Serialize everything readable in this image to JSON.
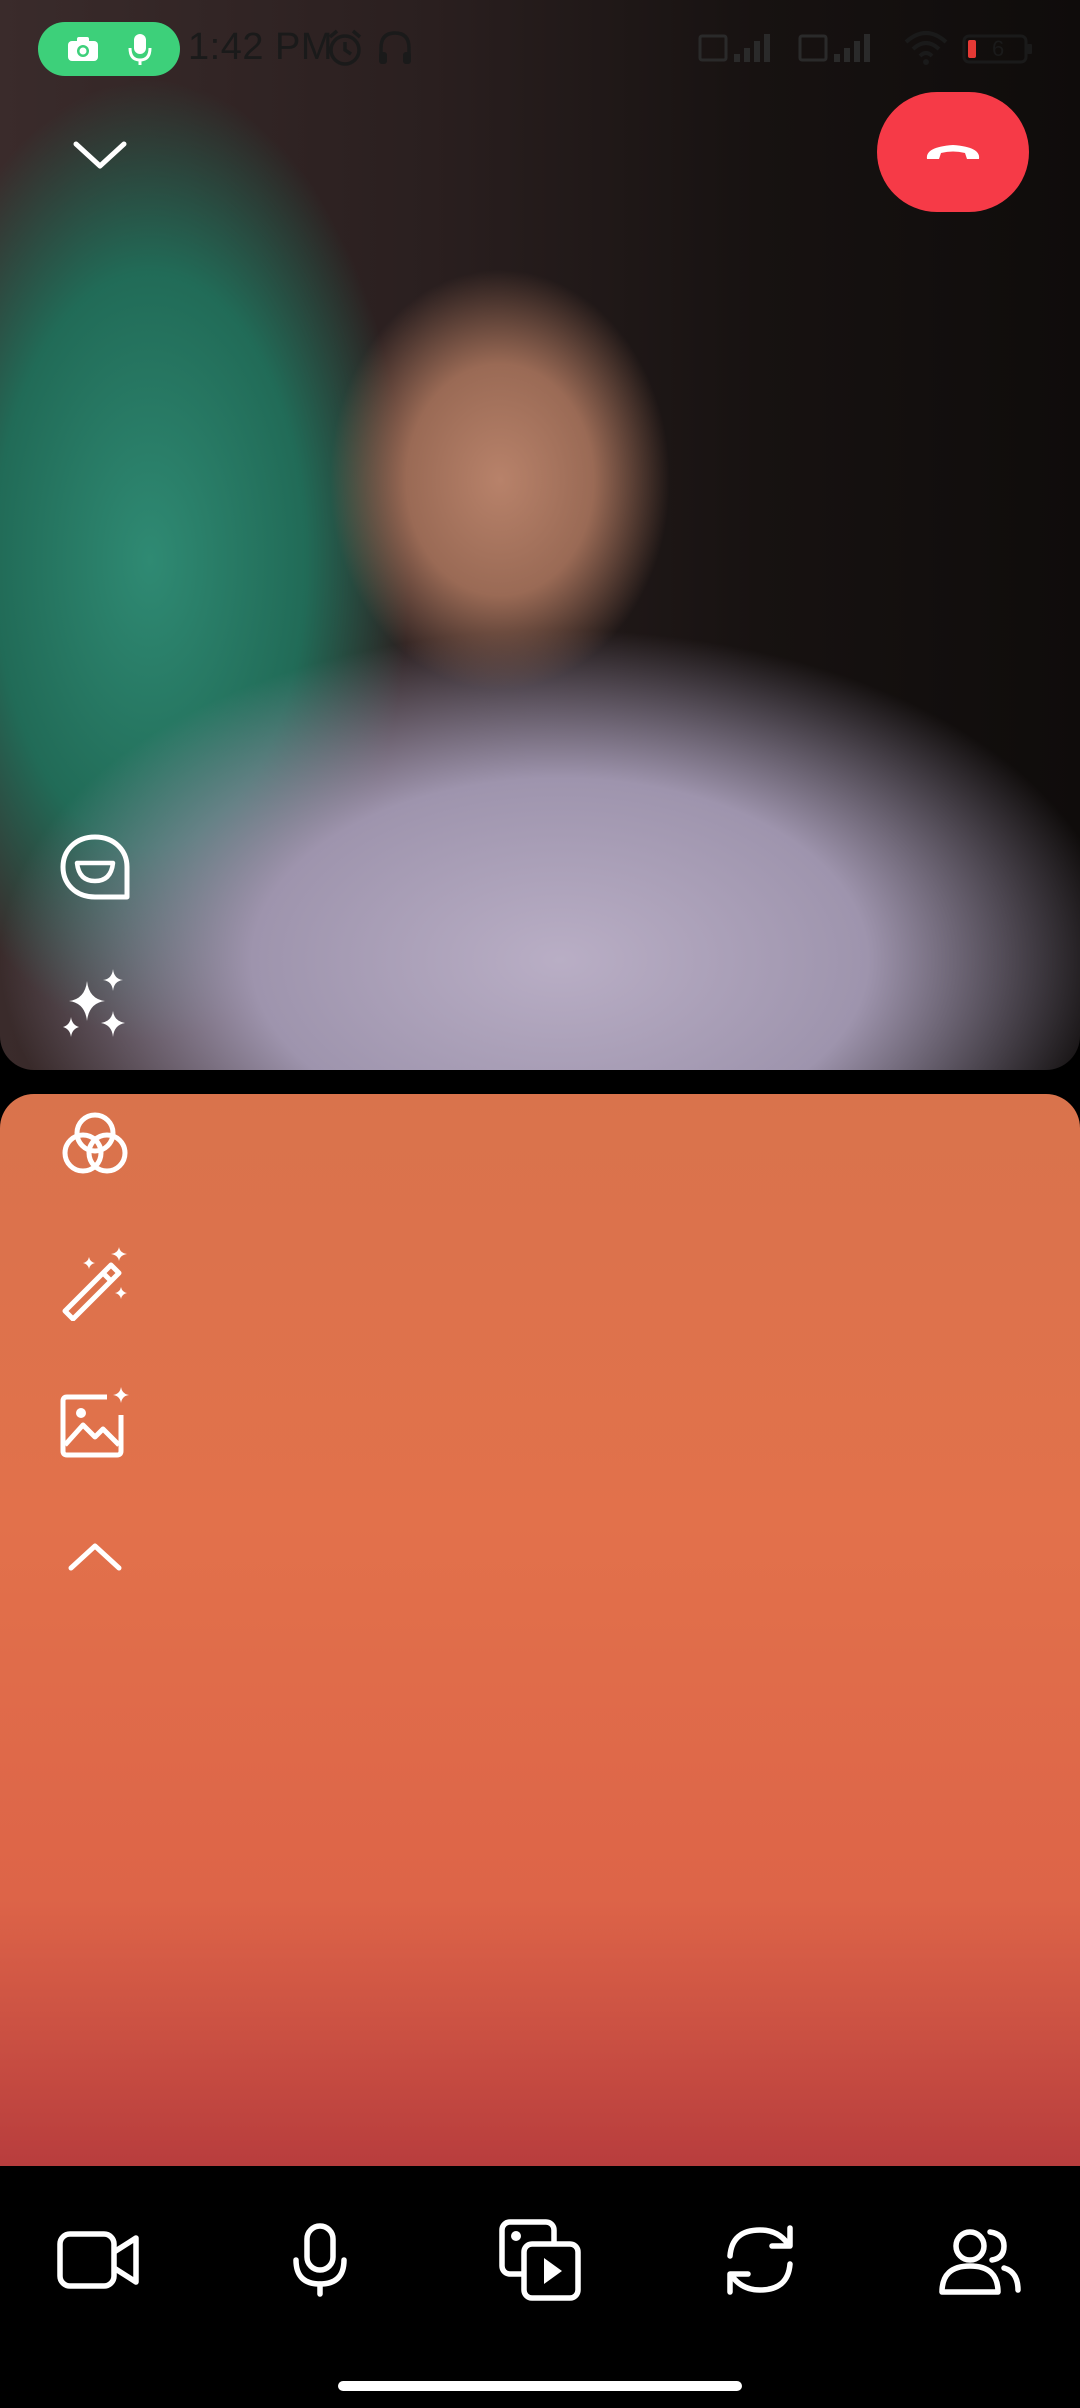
{
  "status_bar": {
    "time": "1:42 PM",
    "battery_level": "6",
    "icons": [
      "camera-icon",
      "mic-icon",
      "alarm-icon",
      "headset-icon",
      "signal-icon",
      "wifi-icon",
      "battery-icon"
    ]
  },
  "call": {
    "participants": 2,
    "top_controls": [
      "chevron-down-icon",
      "end-call-icon"
    ],
    "side_toolbar": [
      "chat-bubble-icon",
      "sparkles-icon",
      "filters-icon",
      "magic-wand-icon",
      "image-sparkle-icon",
      "chevron-up-icon"
    ],
    "bottom_toolbar": [
      "video-camera-icon",
      "microphone-icon",
      "media-share-icon",
      "switch-camera-icon",
      "add-people-icon"
    ]
  },
  "colors": {
    "end_call": "#f63a47",
    "recording_pill": "#3dd07a",
    "background": "#000000"
  }
}
